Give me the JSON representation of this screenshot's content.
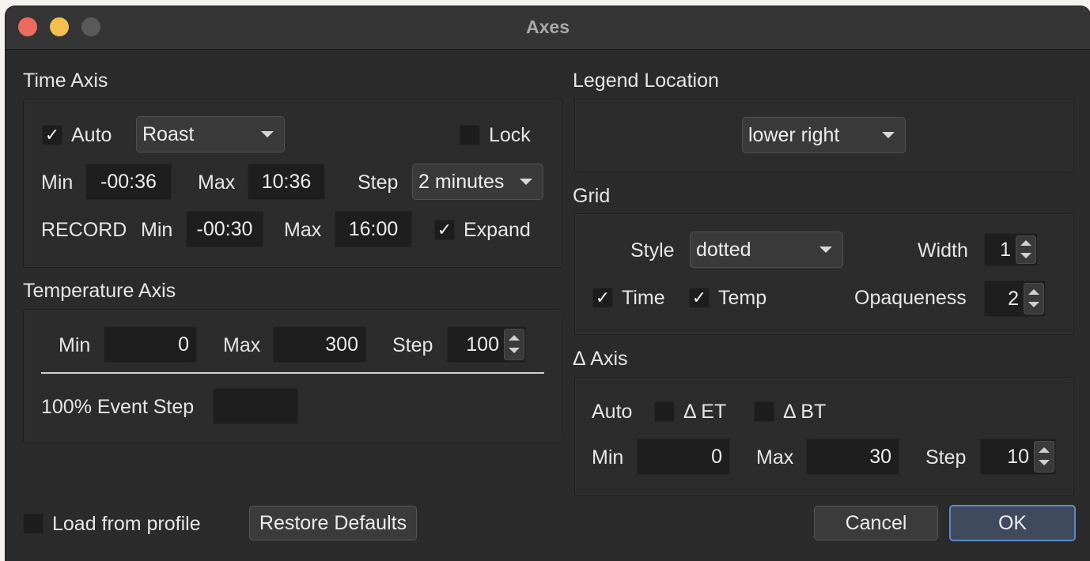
{
  "window": {
    "title": "Axes"
  },
  "time_axis": {
    "section_label": "Time Axis",
    "auto_label": "Auto",
    "auto_checked": "✓",
    "mode_select": "Roast",
    "lock_label": "Lock",
    "min_label": "Min",
    "min_value": "-00:36",
    "max_label": "Max",
    "max_value": "10:36",
    "step_label": "Step",
    "step_select": "2 minutes",
    "record_label": "RECORD",
    "record_min_label": "Min",
    "record_min_value": "-00:30",
    "record_max_label": "Max",
    "record_max_value": "16:00",
    "expand_label": "Expand",
    "expand_checked": "✓"
  },
  "temperature_axis": {
    "section_label": "Temperature Axis",
    "min_label": "Min",
    "min_value": "0",
    "max_label": "Max",
    "max_value": "300",
    "step_label": "Step",
    "step_value": "100",
    "event_step_label": "100% Event Step",
    "event_step_value": ""
  },
  "legend": {
    "section_label": "Legend Location",
    "location_select": "lower right"
  },
  "grid": {
    "section_label": "Grid",
    "style_label": "Style",
    "style_select": "dotted",
    "width_label": "Width",
    "width_value": "1",
    "time_label": "Time",
    "time_checked": "✓",
    "temp_label": "Temp",
    "temp_checked": "✓",
    "opaqueness_label": "Opaqueness",
    "opaqueness_value": "2"
  },
  "delta_axis": {
    "section_label": "Δ  Axis",
    "auto_label": "Auto",
    "et_label": "Δ ET",
    "bt_label": "Δ BT",
    "min_label": "Min",
    "min_value": "0",
    "max_label": "Max",
    "max_value": "30",
    "step_label": "Step",
    "step_value": "10"
  },
  "footer": {
    "load_from_profile_label": "Load from profile",
    "restore_defaults_label": "Restore Defaults",
    "cancel_label": "Cancel",
    "ok_label": "OK"
  },
  "colors": {
    "close": "#ed6a5e",
    "minimize": "#f5bf4f",
    "zoom": "#5a5a5a",
    "default_button_border": "#5f87c2"
  }
}
